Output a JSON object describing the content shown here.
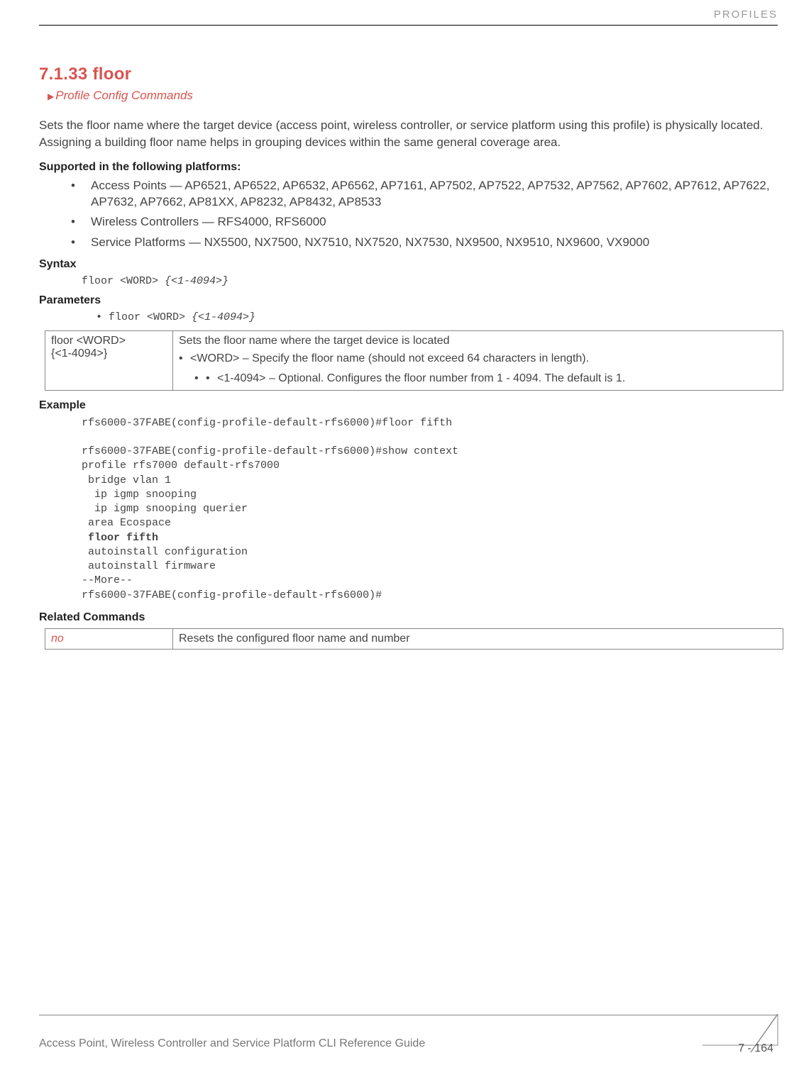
{
  "header": {
    "category": "PROFILES"
  },
  "section": {
    "number_title": "7.1.33 floor",
    "breadcrumb": "Profile Config Commands",
    "intro": "Sets the floor name where the target device (access point, wireless controller, or service platform using this profile) is physically located. Assigning a building floor name helps in grouping devices within the same general coverage area."
  },
  "supported": {
    "heading": "Supported in the following platforms:",
    "items": [
      "Access Points — AP6521, AP6522, AP6532, AP6562, AP7161, AP7502, AP7522, AP7532, AP7562, AP7602, AP7612, AP7622, AP7632, AP7662, AP81XX, AP8232, AP8432, AP8533",
      "Wireless Controllers — RFS4000, RFS6000",
      "Service Platforms — NX5500, NX7500, NX7510, NX7520, NX7530, NX9500, NX9510, NX9600, VX9000"
    ]
  },
  "syntax": {
    "heading": "Syntax",
    "cmd_plain": "floor <WORD> ",
    "cmd_ital": "{<1-4094>}"
  },
  "parameters": {
    "heading": "Parameters",
    "line_plain": "floor <WORD> ",
    "line_ital": "{<1-4094>}",
    "table": {
      "left_l1": "floor <WORD>",
      "left_l2": "{<1-4094>}",
      "right_intro": "Sets the floor name where the target device is located",
      "right_b1": "<WORD> – Specify the floor name (should not exceed 64 characters in length).",
      "right_b2": "<1-4094> – Optional. Configures the floor number from 1 - 4094. The default is 1."
    }
  },
  "example": {
    "heading": "Example",
    "l1": "rfs6000-37FABE(config-profile-default-rfs6000)#floor fifth",
    "l2": "",
    "l3": "rfs6000-37FABE(config-profile-default-rfs6000)#show context",
    "l4": "profile rfs7000 default-rfs7000",
    "l5": " bridge vlan 1",
    "l6": "  ip igmp snooping",
    "l7": "  ip igmp snooping querier",
    "l8": " area Ecospace",
    "l9": " floor fifth",
    "l10": " autoinstall configuration",
    "l11": " autoinstall firmware",
    "l12": "--More--",
    "l13": "rfs6000-37FABE(config-profile-default-rfs6000)#"
  },
  "related": {
    "heading": "Related Commands",
    "cmd": "no",
    "desc": "Resets the configured floor name and number"
  },
  "footer": {
    "doc_title": "Access Point, Wireless Controller and Service Platform CLI Reference Guide",
    "page": "7 - 164"
  }
}
